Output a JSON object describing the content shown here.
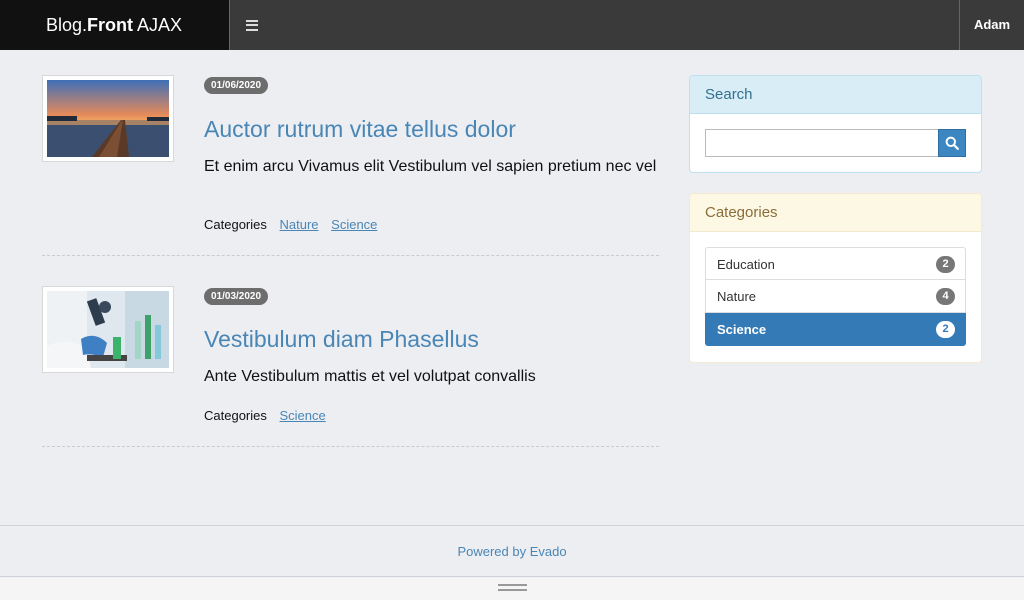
{
  "header": {
    "brand_regular": "Blog.",
    "brand_bold": "Front",
    "brand_suffix": " AJAX",
    "menu_icon": "hamburger-icon",
    "user": "Adam"
  },
  "posts": [
    {
      "date": "01/06/2020",
      "title": "Auctor rutrum vitae tellus dolor",
      "excerpt": "Et enim arcu Vivamus elit Vestibulum vel sapien pretium nec vel",
      "categories_label": "Categories",
      "categories": [
        "Nature",
        "Science"
      ]
    },
    {
      "date": "01/03/2020",
      "title": "Vestibulum diam Phasellus",
      "excerpt": "Ante Vestibulum mattis et vel volutpat convallis",
      "categories_label": "Categories",
      "categories": [
        "Science"
      ]
    }
  ],
  "sidebar": {
    "search": {
      "title": "Search",
      "placeholder": "",
      "value": "",
      "button_icon": "search-icon"
    },
    "categories": {
      "title": "Categories",
      "items": [
        {
          "label": "Education",
          "count": "2",
          "active": false
        },
        {
          "label": "Nature",
          "count": "4",
          "active": false
        },
        {
          "label": "Science",
          "count": "2",
          "active": true
        }
      ]
    }
  },
  "footer": {
    "text": "Powered by Evado"
  },
  "colors": {
    "accent": "#337ab7",
    "link": "#4a86b5",
    "topbar": "#3a3a3a",
    "brand_bg": "#111111"
  }
}
